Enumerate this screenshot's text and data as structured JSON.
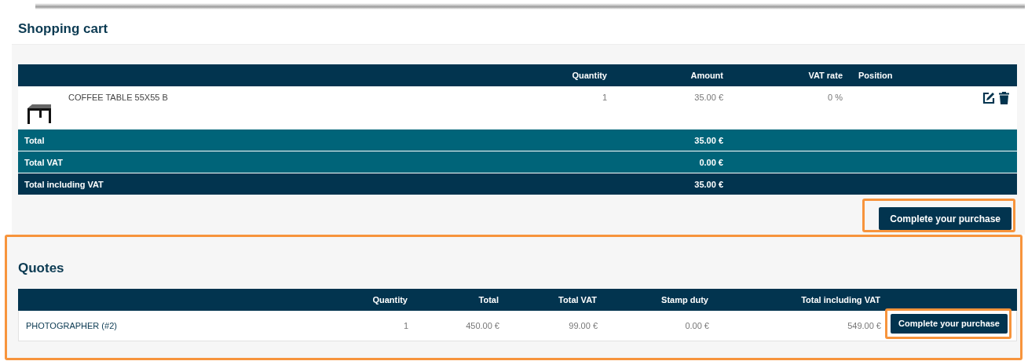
{
  "cart": {
    "title": "Shopping cart",
    "columns": [
      "Quantity",
      "Amount",
      "VAT rate",
      "Position"
    ],
    "items": [
      {
        "name": "COFFEE TABLE 55X55 B",
        "quantity": "1",
        "amount": "35.00 €",
        "vat_rate": "0 %"
      }
    ],
    "totals": [
      {
        "label": "Total",
        "value": "35.00 €",
        "kind": "subtotal"
      },
      {
        "label": "Total VAT",
        "value": "0.00 €",
        "kind": "subtotal"
      },
      {
        "label": "Total including VAT",
        "value": "35.00 €",
        "kind": "grand"
      }
    ],
    "button": {
      "label": "Complete your purchase",
      "highlighted": true
    }
  },
  "quotes": {
    "title": "Quotes",
    "highlighted": true,
    "columns": [
      "Quantity",
      "Total",
      "Total VAT",
      "Stamp duty",
      "Total including VAT"
    ],
    "rows": [
      {
        "name": "PHOTOGRAPHER (#2)",
        "quantity": "1",
        "total": "450.00 €",
        "total_vat": "99.00 €",
        "stamp_duty": "0.00 €",
        "total_including_vat": "549.00 €",
        "button": {
          "label": "Complete your purchase",
          "highlighted": true
        }
      }
    ]
  }
}
